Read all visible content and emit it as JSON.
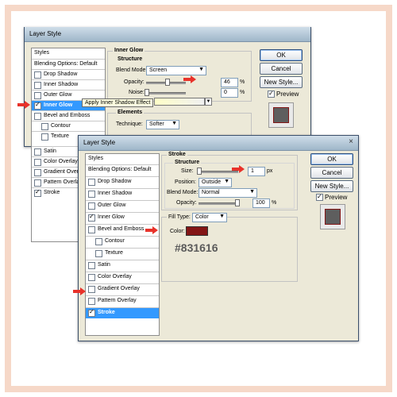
{
  "back_dialog": {
    "title": "Layer Style",
    "styles_header": "Styles",
    "items": [
      {
        "label": "Blending Options: Default",
        "checkbox": false,
        "checked": false
      },
      {
        "label": "Drop Shadow",
        "checkbox": true,
        "checked": false
      },
      {
        "label": "Inner Shadow",
        "checkbox": true,
        "checked": false
      },
      {
        "label": "Outer Glow",
        "checkbox": true,
        "checked": false
      },
      {
        "label": "Inner Glow",
        "checkbox": true,
        "checked": true,
        "selected": true
      },
      {
        "label": "Bevel and Emboss",
        "checkbox": true,
        "checked": false
      },
      {
        "label": "Contour",
        "checkbox": true,
        "checked": false
      },
      {
        "label": "Texture",
        "checkbox": true,
        "checked": false
      },
      {
        "label": "Satin",
        "checkbox": true,
        "checked": false
      },
      {
        "label": "Color Overlay",
        "checkbox": true,
        "checked": false
      },
      {
        "label": "Gradient Overlay",
        "checkbox": true,
        "checked": false
      },
      {
        "label": "Pattern Overlay",
        "checkbox": true,
        "checked": false
      },
      {
        "label": "Stroke",
        "checkbox": true,
        "checked": true
      }
    ],
    "section_title": "Inner Glow",
    "structure_title": "Structure",
    "blend_mode_label": "Blend Mode:",
    "blend_mode_value": "Screen",
    "opacity_label": "Opacity:",
    "opacity_value": "46",
    "opacity_unit": "%",
    "noise_label": "Noise:",
    "noise_value": "0",
    "noise_unit": "%",
    "tooltip": "Apply Inner Shadow Effect",
    "elements_title": "Elements",
    "technique_label": "Technique:",
    "technique_value": "Softer",
    "buttons": {
      "ok": "OK",
      "cancel": "Cancel",
      "new_style": "New Style..."
    },
    "preview_label": "Preview"
  },
  "front_dialog": {
    "title": "Layer Style",
    "close_glyph": "×",
    "styles_header": "Styles",
    "items": [
      {
        "label": "Blending Options: Default",
        "checkbox": false,
        "checked": false
      },
      {
        "label": "Drop Shadow",
        "checkbox": true,
        "checked": false
      },
      {
        "label": "Inner Shadow",
        "checkbox": true,
        "checked": false
      },
      {
        "label": "Outer Glow",
        "checkbox": true,
        "checked": false
      },
      {
        "label": "Inner Glow",
        "checkbox": true,
        "checked": true
      },
      {
        "label": "Bevel and Emboss",
        "checkbox": true,
        "checked": false
      },
      {
        "label": "Contour",
        "checkbox": true,
        "checked": false
      },
      {
        "label": "Texture",
        "checkbox": true,
        "checked": false
      },
      {
        "label": "Satin",
        "checkbox": true,
        "checked": false
      },
      {
        "label": "Color Overlay",
        "checkbox": true,
        "checked": false
      },
      {
        "label": "Gradient Overlay",
        "checkbox": true,
        "checked": false
      },
      {
        "label": "Pattern Overlay",
        "checkbox": true,
        "checked": false
      },
      {
        "label": "Stroke",
        "checkbox": true,
        "checked": true,
        "selected": true
      }
    ],
    "section_title": "Stroke",
    "structure_title": "Structure",
    "size_label": "Size:",
    "size_value": "1",
    "size_unit": "px",
    "position_label": "Position:",
    "position_value": "Outside",
    "blend_mode_label": "Blend Mode:",
    "blend_mode_value": "Normal",
    "opacity_label": "Opacity:",
    "opacity_value": "100",
    "opacity_unit": "%",
    "fill_type_label": "Fill Type:",
    "fill_type_value": "Color",
    "color_label": "Color:",
    "color_hex": "#831616",
    "buttons": {
      "ok": "OK",
      "cancel": "Cancel",
      "new_style": "New Style..."
    },
    "preview_label": "Preview"
  },
  "colors": {
    "stroke_color": "#831616",
    "selection": "#3399ff",
    "arrow": "#e8322a",
    "frame": "#f6d8c8"
  }
}
